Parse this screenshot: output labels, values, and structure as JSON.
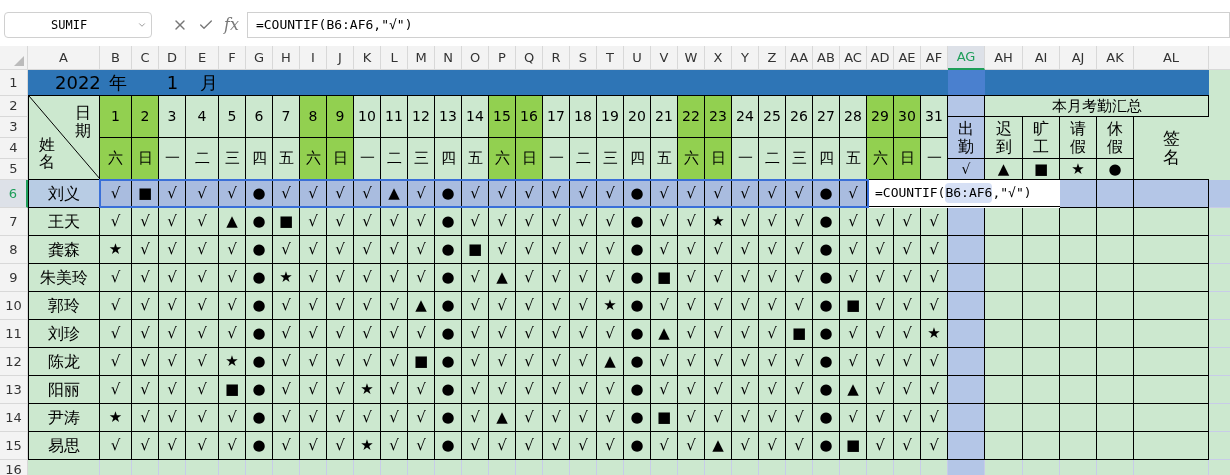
{
  "formula_bar": {
    "name_box": "SUMIF",
    "fx": "fx",
    "formula": "=COUNTIF(B6:AF6,\"√\")"
  },
  "column_headers": [
    {
      "label": "A",
      "selected": false
    },
    {
      "label": "B",
      "selected": false
    },
    {
      "label": "C",
      "selected": false
    },
    {
      "label": "D",
      "selected": false
    },
    {
      "label": "E",
      "selected": false
    },
    {
      "label": "F",
      "selected": false
    },
    {
      "label": "G",
      "selected": false
    },
    {
      "label": "H",
      "selected": false
    },
    {
      "label": "I",
      "selected": false
    },
    {
      "label": "J",
      "selected": false
    },
    {
      "label": "K",
      "selected": false
    },
    {
      "label": "L",
      "selected": false
    },
    {
      "label": "M",
      "selected": false
    },
    {
      "label": "N",
      "selected": false
    },
    {
      "label": "O",
      "selected": false
    },
    {
      "label": "P",
      "selected": false
    },
    {
      "label": "Q",
      "selected": false
    },
    {
      "label": "R",
      "selected": false
    },
    {
      "label": "S",
      "selected": false
    },
    {
      "label": "T",
      "selected": false
    },
    {
      "label": "U",
      "selected": false
    },
    {
      "label": "V",
      "selected": false
    },
    {
      "label": "W",
      "selected": false
    },
    {
      "label": "X",
      "selected": false
    },
    {
      "label": "Y",
      "selected": false
    },
    {
      "label": "Z",
      "selected": false
    },
    {
      "label": "AA",
      "selected": false
    },
    {
      "label": "AB",
      "selected": false
    },
    {
      "label": "AC",
      "selected": false
    },
    {
      "label": "AD",
      "selected": false
    },
    {
      "label": "AE",
      "selected": false
    },
    {
      "label": "AF",
      "selected": false
    },
    {
      "label": "AG",
      "selected": true
    },
    {
      "label": "AH",
      "selected": false
    },
    {
      "label": "AI",
      "selected": false
    },
    {
      "label": "AJ",
      "selected": false
    },
    {
      "label": "AK",
      "selected": false
    },
    {
      "label": "AL",
      "selected": false
    }
  ],
  "row_headers": [
    {
      "label": "1",
      "selected": false
    },
    {
      "label": "2",
      "selected": false
    },
    {
      "label": "3",
      "selected": false
    },
    {
      "label": "4",
      "selected": false
    },
    {
      "label": "5",
      "selected": false
    },
    {
      "label": "6",
      "selected": true
    },
    {
      "label": "7",
      "selected": false
    },
    {
      "label": "8",
      "selected": false
    },
    {
      "label": "9",
      "selected": false
    },
    {
      "label": "10",
      "selected": false
    },
    {
      "label": "11",
      "selected": false
    },
    {
      "label": "12",
      "selected": false
    },
    {
      "label": "13",
      "selected": false
    },
    {
      "label": "14",
      "selected": false
    },
    {
      "label": "15",
      "selected": false
    },
    {
      "label": "16",
      "selected": false
    }
  ],
  "title": {
    "year": "2022",
    "year_unit": "年",
    "month": "1",
    "month_unit": "月"
  },
  "corner": {
    "date_label": "日期",
    "name_label": "姓名"
  },
  "days": [
    {
      "day": "1",
      "weekday": "六",
      "weekend": true
    },
    {
      "day": "2",
      "weekday": "日",
      "weekend": true
    },
    {
      "day": "3",
      "weekday": "一",
      "weekend": false
    },
    {
      "day": "4",
      "weekday": "二",
      "weekend": false
    },
    {
      "day": "5",
      "weekday": "三",
      "weekend": false
    },
    {
      "day": "6",
      "weekday": "四",
      "weekend": false
    },
    {
      "day": "7",
      "weekday": "五",
      "weekend": false
    },
    {
      "day": "8",
      "weekday": "六",
      "weekend": true
    },
    {
      "day": "9",
      "weekday": "日",
      "weekend": true
    },
    {
      "day": "10",
      "weekday": "一",
      "weekend": false
    },
    {
      "day": "11",
      "weekday": "二",
      "weekend": false
    },
    {
      "day": "12",
      "weekday": "三",
      "weekend": false
    },
    {
      "day": "13",
      "weekday": "四",
      "weekend": false
    },
    {
      "day": "14",
      "weekday": "五",
      "weekend": false
    },
    {
      "day": "15",
      "weekday": "六",
      "weekend": true
    },
    {
      "day": "16",
      "weekday": "日",
      "weekend": true
    },
    {
      "day": "17",
      "weekday": "一",
      "weekend": false
    },
    {
      "day": "18",
      "weekday": "二",
      "weekend": false
    },
    {
      "day": "19",
      "weekday": "三",
      "weekend": false
    },
    {
      "day": "20",
      "weekday": "四",
      "weekend": false
    },
    {
      "day": "21",
      "weekday": "五",
      "weekend": false
    },
    {
      "day": "22",
      "weekday": "六",
      "weekend": true
    },
    {
      "day": "23",
      "weekday": "日",
      "weekend": true
    },
    {
      "day": "24",
      "weekday": "一",
      "weekend": false
    },
    {
      "day": "25",
      "weekday": "二",
      "weekend": false
    },
    {
      "day": "26",
      "weekday": "三",
      "weekend": false
    },
    {
      "day": "27",
      "weekday": "四",
      "weekend": false
    },
    {
      "day": "28",
      "weekday": "五",
      "weekend": false
    },
    {
      "day": "29",
      "weekday": "六",
      "weekend": true
    },
    {
      "day": "30",
      "weekday": "日",
      "weekend": true
    },
    {
      "day": "31",
      "weekday": "一",
      "weekend": false
    }
  ],
  "summary": {
    "title": "本月考勤汇总",
    "columns": [
      {
        "label": "出勤",
        "symbol": "√"
      },
      {
        "label": "迟到",
        "symbol": "▲"
      },
      {
        "label": "旷工",
        "symbol": "■"
      },
      {
        "label": "请假",
        "symbol": "★"
      },
      {
        "label": "休假",
        "symbol": "●"
      }
    ],
    "signature": "签名"
  },
  "employees": [
    {
      "name": "刘义",
      "selected": true,
      "marks": [
        "√",
        "■",
        "√",
        "√",
        "√",
        "●",
        "√",
        "√",
        "√",
        "√",
        "▲",
        "√",
        "●",
        "√",
        "√",
        "√",
        "√",
        "√",
        "√",
        "●",
        "√",
        "√",
        "√",
        "√",
        "√",
        "√",
        "●",
        "√"
      ]
    },
    {
      "name": "王天",
      "selected": false,
      "marks": [
        "√",
        "√",
        "√",
        "√",
        "▲",
        "●",
        "■",
        "√",
        "√",
        "√",
        "√",
        "√",
        "●",
        "√",
        "√",
        "√",
        "√",
        "√",
        "√",
        "●",
        "√",
        "√",
        "★",
        "√",
        "√",
        "√",
        "●",
        "√",
        "√",
        "√",
        "√"
      ]
    },
    {
      "name": "龚森",
      "selected": false,
      "marks": [
        "★",
        "√",
        "√",
        "√",
        "√",
        "●",
        "√",
        "√",
        "√",
        "√",
        "√",
        "√",
        "●",
        "■",
        "√",
        "√",
        "√",
        "√",
        "√",
        "●",
        "√",
        "√",
        "√",
        "√",
        "√",
        "√",
        "●",
        "√",
        "√",
        "√",
        "√"
      ]
    },
    {
      "name": "朱美玲",
      "selected": false,
      "marks": [
        "√",
        "√",
        "√",
        "√",
        "√",
        "●",
        "★",
        "√",
        "√",
        "√",
        "√",
        "√",
        "●",
        "√",
        "▲",
        "√",
        "√",
        "√",
        "√",
        "●",
        "■",
        "√",
        "√",
        "√",
        "√",
        "√",
        "●",
        "√",
        "√",
        "√",
        "√"
      ]
    },
    {
      "name": "郭玲",
      "selected": false,
      "marks": [
        "√",
        "√",
        "√",
        "√",
        "√",
        "●",
        "√",
        "√",
        "√",
        "√",
        "√",
        "▲",
        "●",
        "√",
        "√",
        "√",
        "√",
        "√",
        "★",
        "●",
        "√",
        "√",
        "√",
        "√",
        "√",
        "√",
        "●",
        "■",
        "√",
        "√",
        "√"
      ]
    },
    {
      "name": "刘珍",
      "selected": false,
      "marks": [
        "√",
        "√",
        "√",
        "√",
        "√",
        "●",
        "√",
        "√",
        "√",
        "√",
        "√",
        "√",
        "●",
        "√",
        "√",
        "√",
        "√",
        "√",
        "√",
        "●",
        "▲",
        "√",
        "√",
        "√",
        "√",
        "■",
        "●",
        "√",
        "√",
        "√",
        "★"
      ]
    },
    {
      "name": "陈龙",
      "selected": false,
      "marks": [
        "√",
        "√",
        "√",
        "√",
        "★",
        "●",
        "√",
        "√",
        "√",
        "√",
        "√",
        "■",
        "●",
        "√",
        "√",
        "√",
        "√",
        "√",
        "▲",
        "●",
        "√",
        "√",
        "√",
        "√",
        "√",
        "√",
        "●",
        "√",
        "√",
        "√",
        "√"
      ]
    },
    {
      "name": "阳丽",
      "selected": false,
      "marks": [
        "√",
        "√",
        "√",
        "√",
        "■",
        "●",
        "√",
        "√",
        "√",
        "★",
        "√",
        "√",
        "●",
        "√",
        "√",
        "√",
        "√",
        "√",
        "√",
        "●",
        "√",
        "√",
        "√",
        "√",
        "√",
        "√",
        "●",
        "▲",
        "√",
        "√",
        "√"
      ]
    },
    {
      "name": "尹涛",
      "selected": false,
      "marks": [
        "★",
        "√",
        "√",
        "√",
        "√",
        "●",
        "√",
        "√",
        "√",
        "√",
        "√",
        "√",
        "●",
        "√",
        "▲",
        "√",
        "√",
        "√",
        "√",
        "●",
        "■",
        "√",
        "√",
        "√",
        "√",
        "√",
        "●",
        "√",
        "√",
        "√",
        "√"
      ]
    },
    {
      "name": "易思",
      "selected": false,
      "marks": [
        "√",
        "√",
        "√",
        "√",
        "√",
        "●",
        "√",
        "√",
        "√",
        "★",
        "√",
        "√",
        "●",
        "√",
        "√",
        "√",
        "√",
        "√",
        "√",
        "●",
        "√",
        "√",
        "▲",
        "√",
        "√",
        "√",
        "●",
        "■",
        "√",
        "√",
        "√"
      ]
    }
  ],
  "cell_editor": {
    "prefix": "=COUNTIF(",
    "range": "B6:AF6",
    "suffix": ",\"√\")"
  }
}
